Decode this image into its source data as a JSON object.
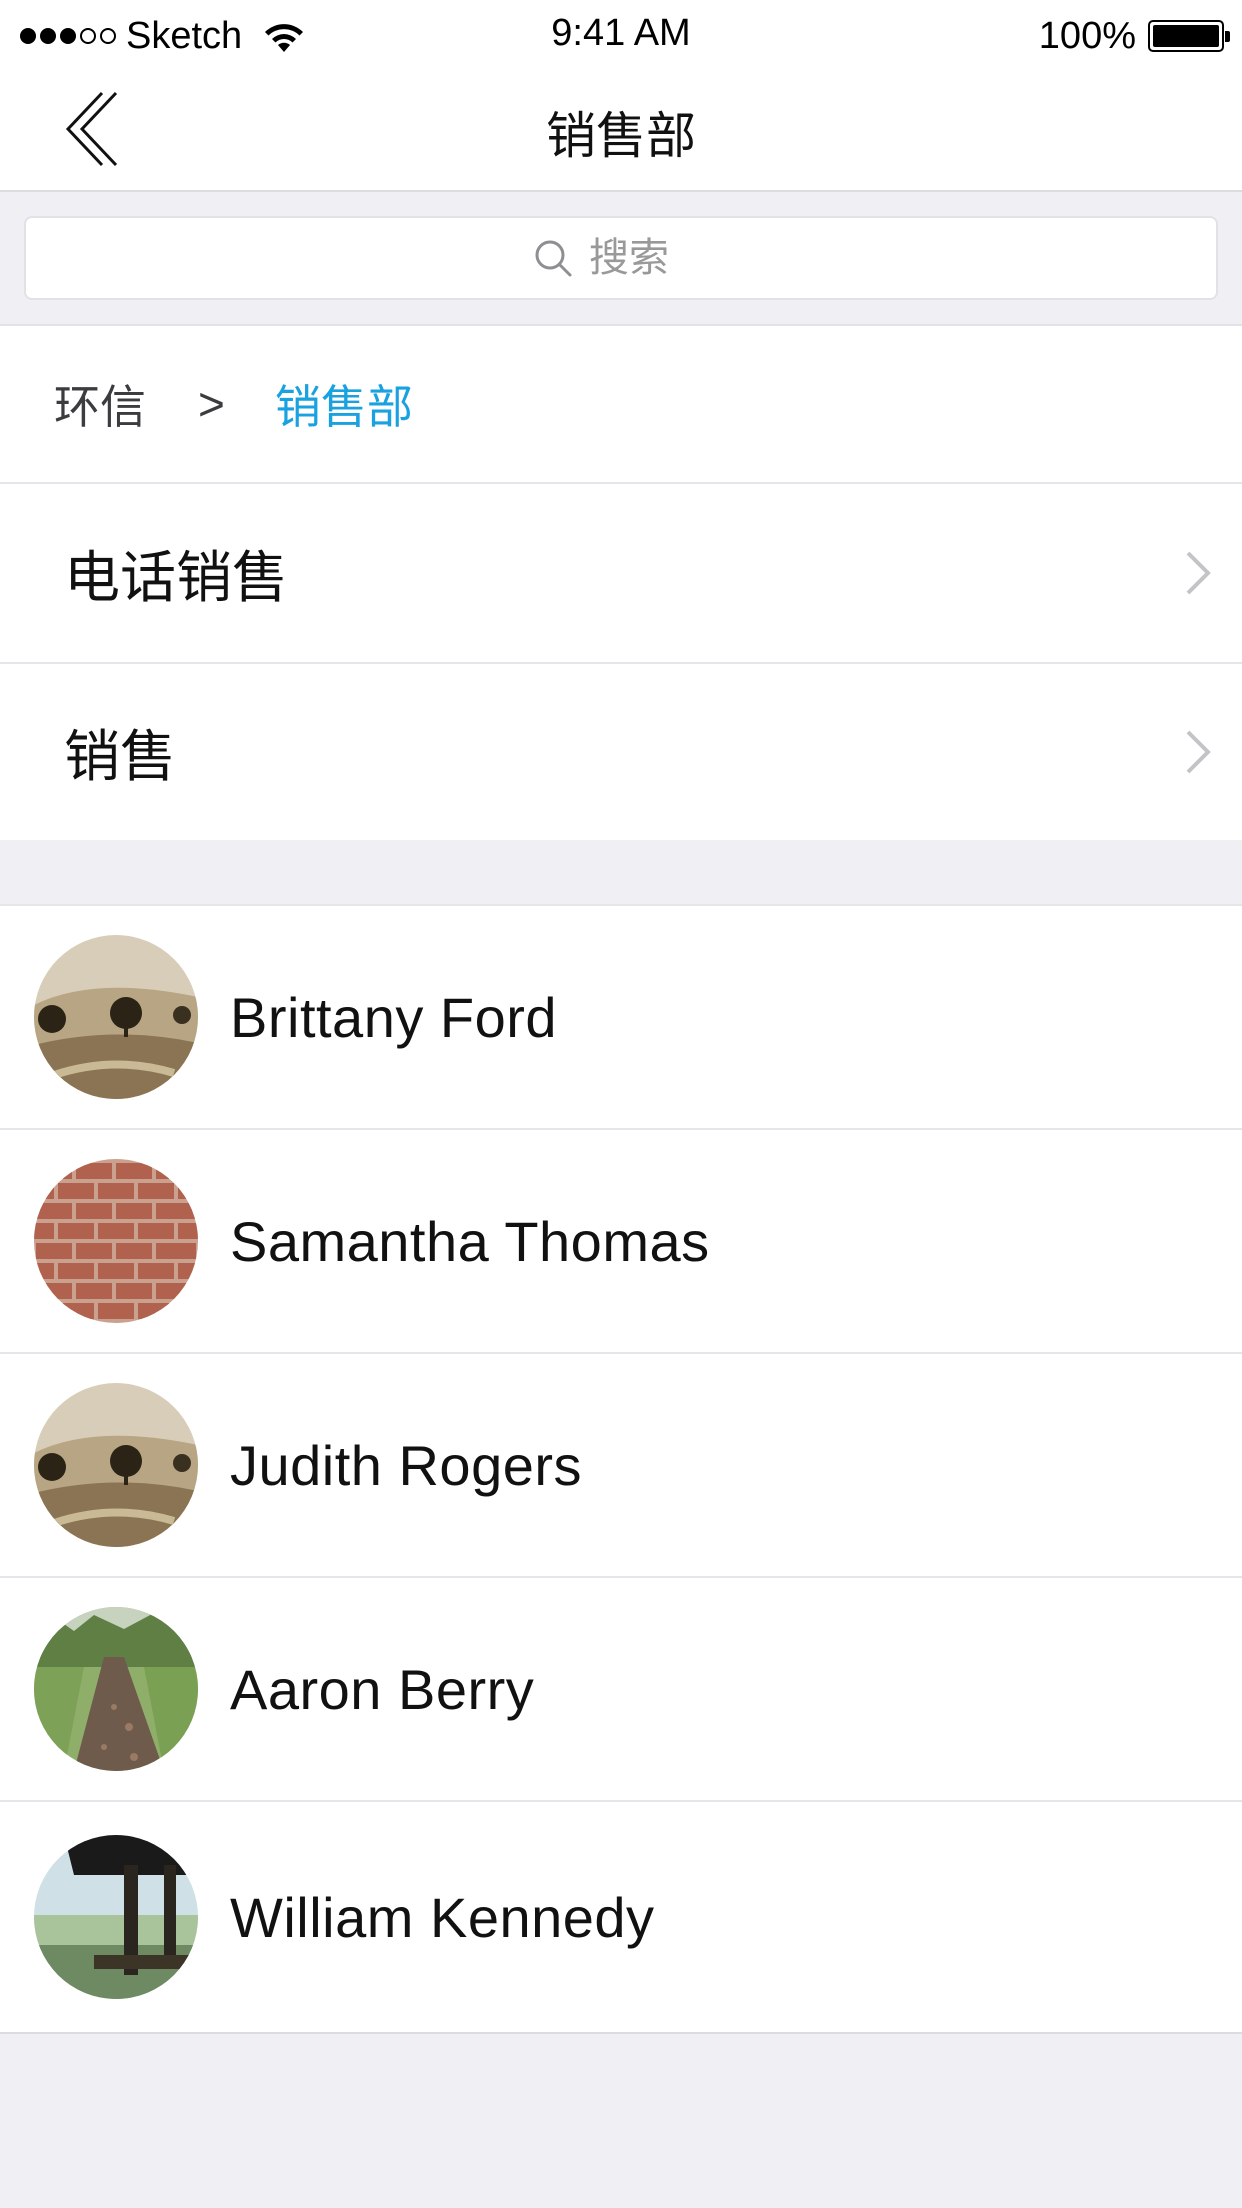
{
  "status_bar": {
    "carrier": "Sketch",
    "time": "9:41 AM",
    "battery": "100%"
  },
  "nav": {
    "title": "销售部"
  },
  "search": {
    "placeholder": "搜索"
  },
  "breadcrumb": {
    "root": "环信",
    "separator": ">",
    "current": "销售部"
  },
  "departments": [
    {
      "label": "电话销售"
    },
    {
      "label": "销售"
    }
  ],
  "contacts": [
    {
      "name": "Brittany Ford",
      "avatar": "landscape-photo"
    },
    {
      "name": "Samantha Thomas",
      "avatar": "brick-wall-photo"
    },
    {
      "name": "Judith Rogers",
      "avatar": "landscape-photo"
    },
    {
      "name": "Aaron Berry",
      "avatar": "forest-path-photo"
    },
    {
      "name": "William Kennedy",
      "avatar": "pier-photo"
    }
  ],
  "colors": {
    "accent": "#1aa1e0",
    "background": "#efeff4",
    "separator": "#e6e6ea"
  }
}
